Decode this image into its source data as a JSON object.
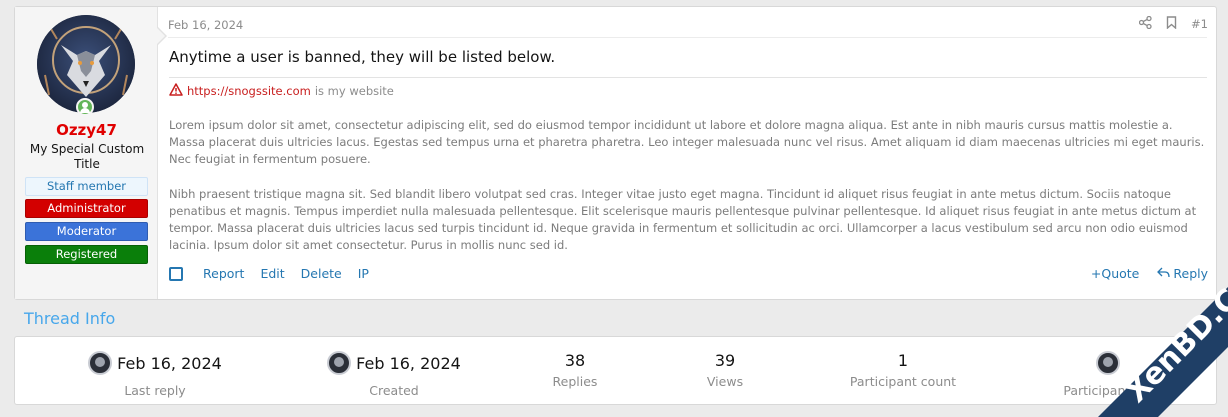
{
  "post": {
    "date": "Feb 16, 2024",
    "number": "#1",
    "headline": "Anytime a user is banned, they will be listed below.",
    "site_url": "https://snogssite.com",
    "site_suffix": "is my website",
    "paragraphs": [
      "Lorem ipsum dolor sit amet, consectetur adipiscing elit, sed do eiusmod tempor incididunt ut labore et dolore magna aliqua. Est ante in nibh mauris cursus mattis molestie a. Massa placerat duis ultricies lacus. Egestas sed tempus urna et pharetra pharetra. Leo integer malesuada nunc vel risus. Amet aliquam id diam maecenas ultricies mi eget mauris. Nec feugiat in fermentum posuere.",
      "Nibh praesent tristique magna sit. Sed blandit libero volutpat sed cras. Integer vitae justo eget magna. Tincidunt id aliquet risus feugiat in ante metus dictum. Sociis natoque penatibus et magnis. Tempus imperdiet nulla malesuada pellentesque. Elit scelerisque mauris pellentesque pulvinar pellentesque. Id aliquet risus feugiat in ante metus dictum at tempor. Massa placerat duis ultricies lacus sed turpis tincidunt id. Neque gravida in fermentum et sollicitudin ac orci. Ullamcorper a lacus vestibulum sed arcu non odio euismod lacinia. Ipsum dolor sit amet consectetur. Purus in mollis nunc sed id."
    ],
    "actions": {
      "report": "Report",
      "edit": "Edit",
      "delete": "Delete",
      "ip": "IP"
    },
    "actions_right": {
      "quote": "+Quote",
      "reply": "Reply"
    }
  },
  "user": {
    "name": "Ozzy47",
    "title": "My Special Custom Title",
    "banners": [
      "Staff member",
      "Administrator",
      "Moderator",
      "Registered"
    ],
    "name_color": "#e00000"
  },
  "thread_info": {
    "title": "Thread Info",
    "stats": [
      {
        "value": "Feb 16, 2024",
        "label": "Last reply",
        "avatar": true
      },
      {
        "value": "Feb 16, 2024",
        "label": "Created",
        "avatar": true
      },
      {
        "value": "38",
        "label": "Replies",
        "avatar": false
      },
      {
        "value": "39",
        "label": "Views",
        "avatar": false
      },
      {
        "value": "1",
        "label": "Participant count",
        "avatar": false
      },
      {
        "value": "",
        "label": "Participant list",
        "avatar": true
      }
    ]
  },
  "watermark": {
    "text": "XenBD.Com",
    "color": "#1f3f66"
  },
  "icons": {
    "share": "share-icon",
    "bookmark": "bookmark-icon",
    "warning": "warning-icon",
    "reply": "reply-icon"
  }
}
